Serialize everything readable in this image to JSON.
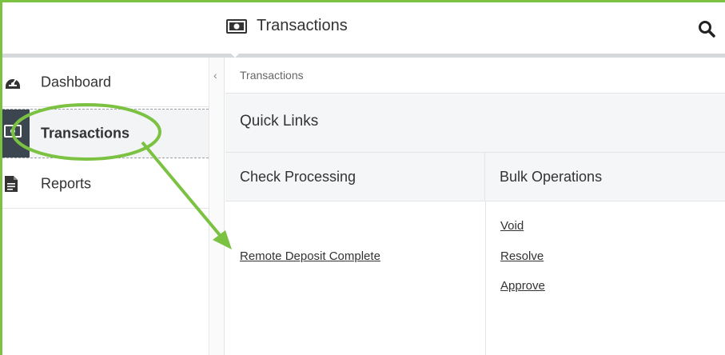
{
  "header": {
    "title": "Transactions",
    "title_icon": "cash-icon",
    "search_icon": "search-icon"
  },
  "sidebar": {
    "collapse_icon": "chevron-left-icon",
    "collapse_glyph": "‹",
    "items": [
      {
        "label": "Dashboard",
        "icon": "dashboard-icon",
        "active": false
      },
      {
        "label": "Transactions",
        "icon": "cash-icon",
        "active": true
      },
      {
        "label": "Reports",
        "icon": "document-icon",
        "active": false
      }
    ]
  },
  "main": {
    "breadcrumb": "Transactions",
    "quick_links_title": "Quick Links",
    "columns": [
      {
        "title": "Check Processing",
        "links": [
          "Remote Deposit Complete"
        ]
      },
      {
        "title": "Bulk Operations",
        "links": [
          "Void",
          "Resolve",
          "Approve"
        ]
      }
    ]
  },
  "colors": {
    "annotation_green": "#7cc242",
    "active_block": "#3c4650",
    "panel_bg": "#f5f6f7"
  }
}
